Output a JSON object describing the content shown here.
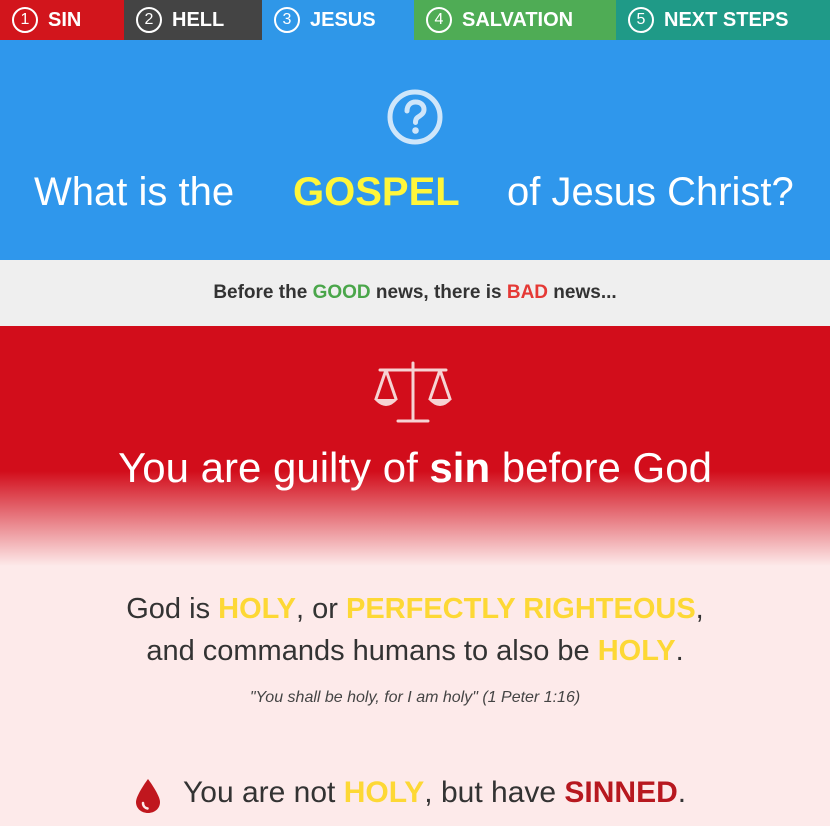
{
  "nav": {
    "items": [
      {
        "number": "1",
        "label": "SIN",
        "color": "#d2151c"
      },
      {
        "number": "2",
        "label": "HELL",
        "color": "#444444"
      },
      {
        "number": "3",
        "label": "JESUS",
        "color": "#2f97e8"
      },
      {
        "number": "4",
        "label": "SALVATION",
        "color": "#4fac55"
      },
      {
        "number": "5",
        "label": "NEXT STEPS",
        "color": "#1f9a87"
      }
    ]
  },
  "hero": {
    "icon": "question-circle-icon",
    "title_part1": "What is the",
    "title_highlight": "GOSPEL",
    "title_part2": "of Jesus Christ?",
    "background": "#2f97ec",
    "highlight_color": "#fff63a"
  },
  "intro": {
    "part1": "Before the ",
    "good": "GOOD",
    "part2": " news, there is ",
    "bad": "BAD",
    "part3": " news..."
  },
  "sin_section": {
    "icon": "scales-icon",
    "title_part1": "You are guilty of ",
    "title_bold": "sin",
    "title_part2": " before God",
    "background": "#d20d1b"
  },
  "holy_statement": {
    "line1_part1": "God is ",
    "holy1": "HOLY",
    "line1_part2": ", or ",
    "perfectly_righteous": "PERFECTLY RIGHTEOUS",
    "line1_part3": ",",
    "line2_part1": "and commands humans to also be ",
    "holy2": "HOLY",
    "line2_part2": "."
  },
  "verse": "\"You shall be holy, for I am holy\" (1 Peter 1:16)",
  "not_holy": {
    "icon": "blood-drop-icon",
    "part1": "You are not ",
    "holy": "HOLY",
    "part2": ", but have ",
    "sinned": "SINNED",
    "part3": "."
  }
}
